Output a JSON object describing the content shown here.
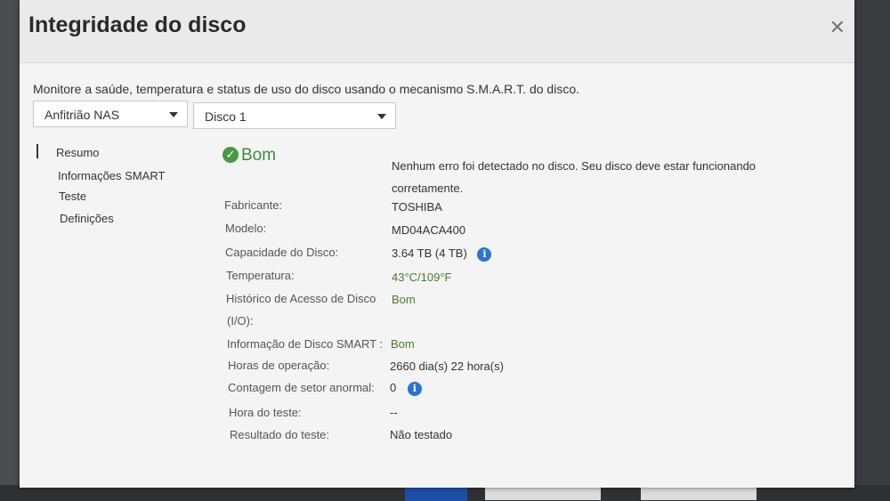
{
  "dialog": {
    "title": "Integridade do disco",
    "close_glyph": "✕",
    "description": "Monitore a saúde, temperatura e status de uso do disco usando o mecanismo S.M.A.R.T. do disco."
  },
  "selectors": {
    "host": "Anfitrião NAS",
    "disk": "Disco 1"
  },
  "nav": {
    "items": [
      "Resumo",
      "Informações SMART",
      "Teste",
      "Definições"
    ],
    "selected": "Resumo"
  },
  "summary": {
    "status": "Bom",
    "message": "Nenhum erro foi detectado no disco. Seu disco deve estar funcionando corretamente.",
    "fields": {
      "manufacturer": {
        "label": "Fabricante:",
        "value": "TOSHIBA"
      },
      "model": {
        "label": "Modelo:",
        "value": "MD04ACA400"
      },
      "capacity": {
        "label": "Capacidade do Disco:",
        "value": "3.64 TB (4 TB)"
      },
      "temperature": {
        "label": "Temperatura:",
        "value": "43°C/109°F"
      },
      "access_history_line1": "Histórico de Acesso de Disco",
      "access_history_line2": "(I/O):",
      "access_history_value": "Bom",
      "smart_info": {
        "label": "Informação de Disco SMART :",
        "value": "Bom"
      },
      "operating_hours": {
        "label": "Horas de operação:",
        "value": "2660 dia(s) 22 hora(s)"
      },
      "abnormal_sectors": {
        "label": "Contagem de setor anormal:",
        "value": "0"
      },
      "test_time": {
        "label": "Hora do teste:",
        "value": "--"
      },
      "test_result": {
        "label": "Resultado do teste:",
        "value": "Não testado"
      }
    }
  },
  "colors": {
    "status_green": "#4a9a45",
    "info_blue": "#2b73d8"
  }
}
